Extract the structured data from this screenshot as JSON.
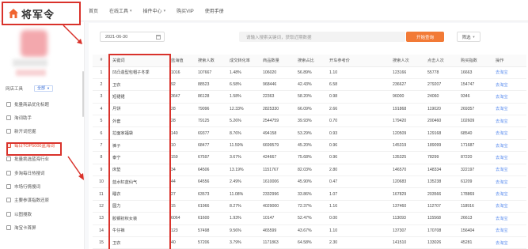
{
  "brand": {
    "name": "将军令"
  },
  "nav": {
    "items": [
      {
        "label": "首页",
        "has_dropdown": false
      },
      {
        "label": "在线工具",
        "has_dropdown": true
      },
      {
        "label": "插件中心",
        "has_dropdown": true,
        "badge": ""
      },
      {
        "label": "购买VIP",
        "has_dropdown": false
      },
      {
        "label": "使用手册",
        "has_dropdown": false
      }
    ]
  },
  "sidebar": {
    "section_label": "网店工具",
    "section_select": "全部",
    "items": [
      {
        "label": "批量商品优化标题",
        "tag": "",
        "active": false
      },
      {
        "label": "淘词助手",
        "tag": "",
        "active": false
      },
      {
        "label": "新开词挖掘",
        "tag": "",
        "active": false
      },
      {
        "label": "每日TOP5000蓝海词",
        "tag": "",
        "active": true
      },
      {
        "label": "批量挑选蓝海行业",
        "tag": "",
        "active": false
      },
      {
        "label": "多淘每日热搜词",
        "tag": "",
        "active": false
      },
      {
        "label": "市场行情搜词",
        "tag": "",
        "active": false
      },
      {
        "label": "主要参谋指数还原",
        "tag": "",
        "active": false
      },
      {
        "label": "以图搜款",
        "tag": "",
        "active": false
      },
      {
        "label": "淘宝卡首屏",
        "tag": "",
        "active": false
      }
    ]
  },
  "toolbar": {
    "date_value": "2021-06-30",
    "search_placeholder": "请输入搜索关键词，获取近期数据",
    "search_button": "开始查询",
    "filter_button": "筛选"
  },
  "table": {
    "headers": [
      "#",
      "关键词",
      "蓝海值",
      "搜索人数",
      "成交转化率",
      "商品数量",
      "搜索占比",
      "开车参考价",
      "",
      "搜索人次",
      "点击人次",
      "购买指数",
      "操作"
    ],
    "rows": [
      [
        "1",
        "凹凸造型包帽子冬季",
        "1016",
        "107667",
        "1.48%",
        "106020",
        "56.89%",
        "1.10",
        "",
        "123166",
        "55778",
        "16663",
        "去淘宝"
      ],
      [
        "2",
        "卫衣",
        "92",
        "88523",
        "6.58%",
        "968446",
        "42.43%",
        "6.58",
        "",
        "236627",
        "279207",
        "154747",
        "去淘宝"
      ],
      [
        "3",
        "短裙裙",
        "3647",
        "86128",
        "1.58%",
        "22363",
        "58.20%",
        "0.98",
        "",
        "96000",
        "24060",
        "9346",
        "去淘宝"
      ],
      [
        "4",
        "月饼",
        "28",
        "79096",
        "12.33%",
        "2825330",
        "66.09%",
        "2.66",
        "",
        "191868",
        "119020",
        "269357",
        "去淘宝"
      ],
      [
        "5",
        "外套",
        "28",
        "79125",
        "5.26%",
        "2544759",
        "39.93%",
        "0.70",
        "",
        "179420",
        "200460",
        "102609",
        "去淘宝"
      ],
      [
        "6",
        "拉面家福袋",
        "140",
        "69377",
        "8.76%",
        "494158",
        "53.29%",
        "0.93",
        "",
        "120509",
        "129168",
        "68540",
        "去淘宝"
      ],
      [
        "7",
        "裤子",
        "10",
        "68477",
        "11.59%",
        "6699579",
        "45.20%",
        "0.96",
        "",
        "145319",
        "189099",
        "171687",
        "去淘宝"
      ],
      [
        "8",
        "泰宁",
        "159",
        "67597",
        "3.67%",
        "424667",
        "75.68%",
        "0.96",
        "",
        "135325",
        "78299",
        "87220",
        "去淘宝"
      ],
      [
        "9",
        "床垫",
        "34",
        "64506",
        "13.19%",
        "1151767",
        "82.03%",
        "2.80",
        "",
        "146570",
        "148334",
        "322197",
        "去淘宝"
      ],
      [
        "10",
        "蓝水缸蓝仙气",
        "44",
        "64556",
        "2.49%",
        "1610006",
        "45.90%",
        "0.47",
        "",
        "120683",
        "135238",
        "61209",
        "去淘宝"
      ],
      [
        "11",
        "睡衣",
        "27",
        "63573",
        "11.08%",
        "2332996",
        "33.86%",
        "1.07",
        "",
        "167829",
        "203566",
        "178869",
        "去淘宝"
      ],
      [
        "12",
        "圆力",
        "15",
        "61966",
        "8.27%",
        "4029000",
        "72.37%",
        "1.16",
        "",
        "137460",
        "112707",
        "118916",
        "去淘宝"
      ],
      [
        "13",
        "胶钢初秋女装",
        "6064",
        "61600",
        "1.93%",
        "10147",
        "52.47%",
        "0.00",
        "",
        "113093",
        "115568",
        "26613",
        "去淘宝"
      ],
      [
        "14",
        "牛仔裤",
        "123",
        "57498",
        "9.56%",
        "465599",
        "43.67%",
        "1.10",
        "",
        "137307",
        "170708",
        "156404",
        "去淘宝"
      ],
      [
        "15",
        "卫衣",
        "40",
        "57206",
        "3.79%",
        "1171863",
        "64.58%",
        "2.30",
        "",
        "141510",
        "133026",
        "45281",
        "去淘宝"
      ]
    ]
  },
  "colors": {
    "accent": "#f27a36",
    "annotation_red": "#d9322b",
    "link": "#5b8def",
    "active_menu": "#e2462c"
  }
}
